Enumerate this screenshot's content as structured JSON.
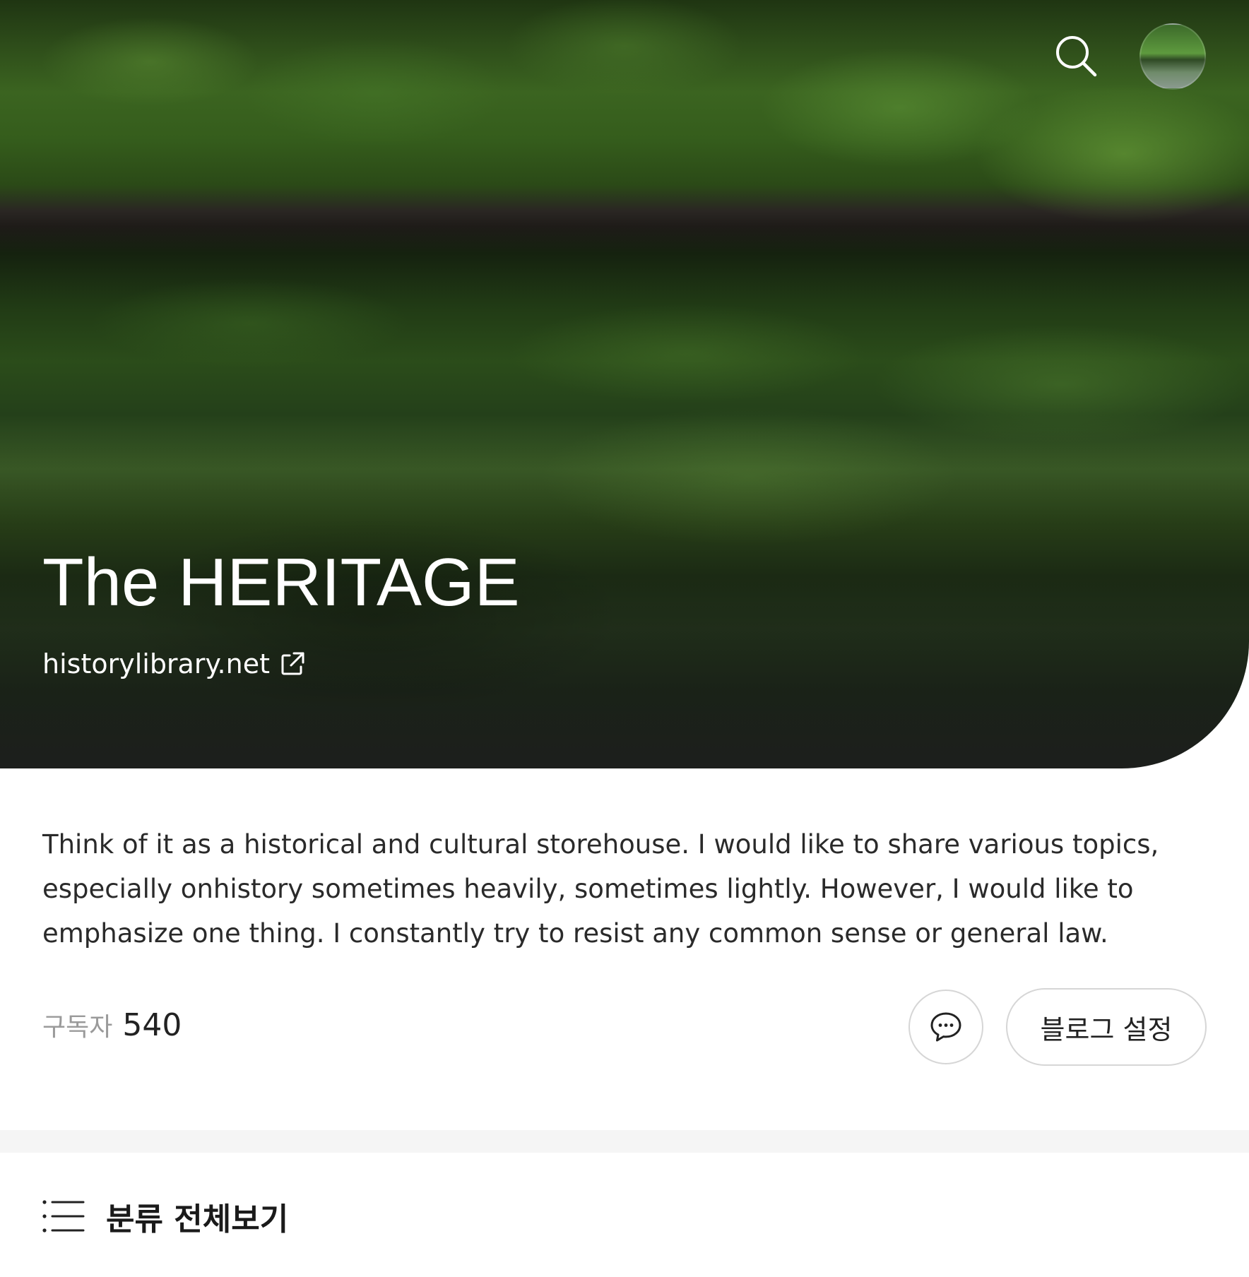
{
  "header": {
    "search_icon": "search-icon",
    "avatar_label": "profile-avatar"
  },
  "blog": {
    "title": "The HERITAGE",
    "url": "historylibrary.net",
    "external_icon": "external-link-icon",
    "description": "Think of it as a historical and cultural storehouse. I would like to share various topics, especially onhistory sometimes heavily, sometimes lightly. However, I would like to emphasize one thing. I constantly try to resist any common sense or general law."
  },
  "stats": {
    "subscribers_label": "구독자",
    "subscribers_count": "540"
  },
  "actions": {
    "chat_icon": "chat-bubble-icon",
    "settings_label": "블로그 설정"
  },
  "category": {
    "icon": "list-icon",
    "label": "분류 전체보기"
  },
  "colors": {
    "text_primary": "#1a1a1a",
    "text_secondary": "#9a9a9a",
    "border": "#d6d6d6",
    "divider": "#f5f5f5",
    "hero_text": "#ffffff"
  }
}
